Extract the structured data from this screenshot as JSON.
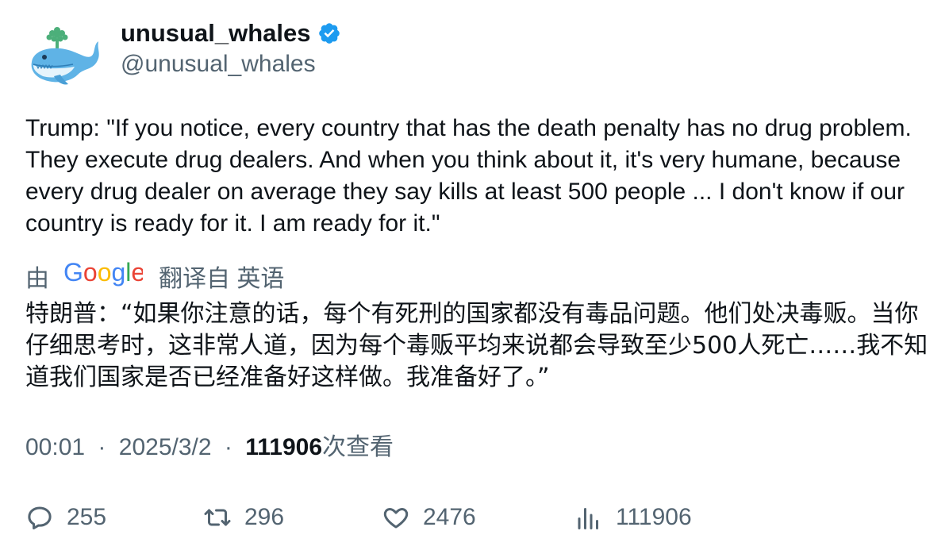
{
  "author": {
    "display_name": "unusual_whales",
    "handle": "@unusual_whales",
    "verified": true,
    "avatar_icon": "whale-logo"
  },
  "tweet": {
    "text": "Trump: \"If you notice, every country that has the death penalty has no drug problem. They execute drug dealers. And when you think about it, it's very humane, because every drug dealer on average they say kills at least 500 people ... I don't know if our country is ready for it. I am ready for it.\"",
    "translation_prefix": "由",
    "translation_provider": "Google",
    "translation_suffix": "翻译自 英语",
    "translated_text": "特朗普：“如果你注意的话，每个有死刑的国家都没有毒品问题。他们处决毒贩。当你仔细思考时，这非常人道，因为每个毒贩平均来说都会导致至少500人死亡……我不知道我们国家是否已经准备好这样做。我准备好了。”"
  },
  "meta": {
    "time": "00:01",
    "date": "2025/3/2",
    "separator": "·",
    "views": "111906",
    "views_label": "次查看"
  },
  "actions": {
    "replies": "255",
    "retweets": "296",
    "likes": "2476",
    "views": "111906"
  },
  "colors": {
    "text_primary": "#0f1419",
    "text_secondary": "#536471",
    "verified_blue": "#1d9bf0",
    "whale_blue": "#5fb3e6"
  }
}
